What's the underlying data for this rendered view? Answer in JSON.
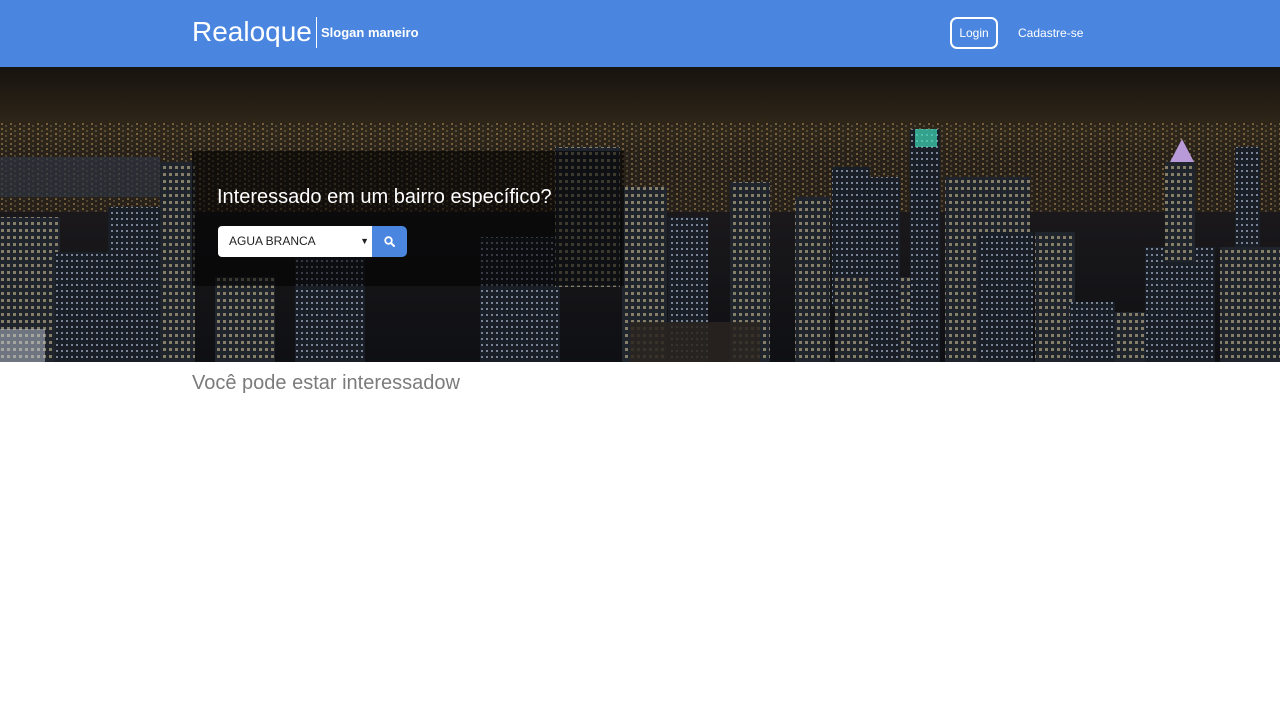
{
  "header": {
    "brand": "Realoque",
    "slogan": "Slogan maneiro",
    "login_label": "Login",
    "signup_label": "Cadastre-se"
  },
  "hero": {
    "background": "night-city-skyline-photo",
    "title": "Interessado em um bairro específico?",
    "neighborhood_select": {
      "selected": "AGUA BRANCA"
    },
    "search_icon": "search-icon"
  },
  "main": {
    "section_title": "Você pode estar interessadow"
  },
  "colors": {
    "brand_blue": "#4a86e0",
    "muted_text": "#7b7b7b"
  }
}
